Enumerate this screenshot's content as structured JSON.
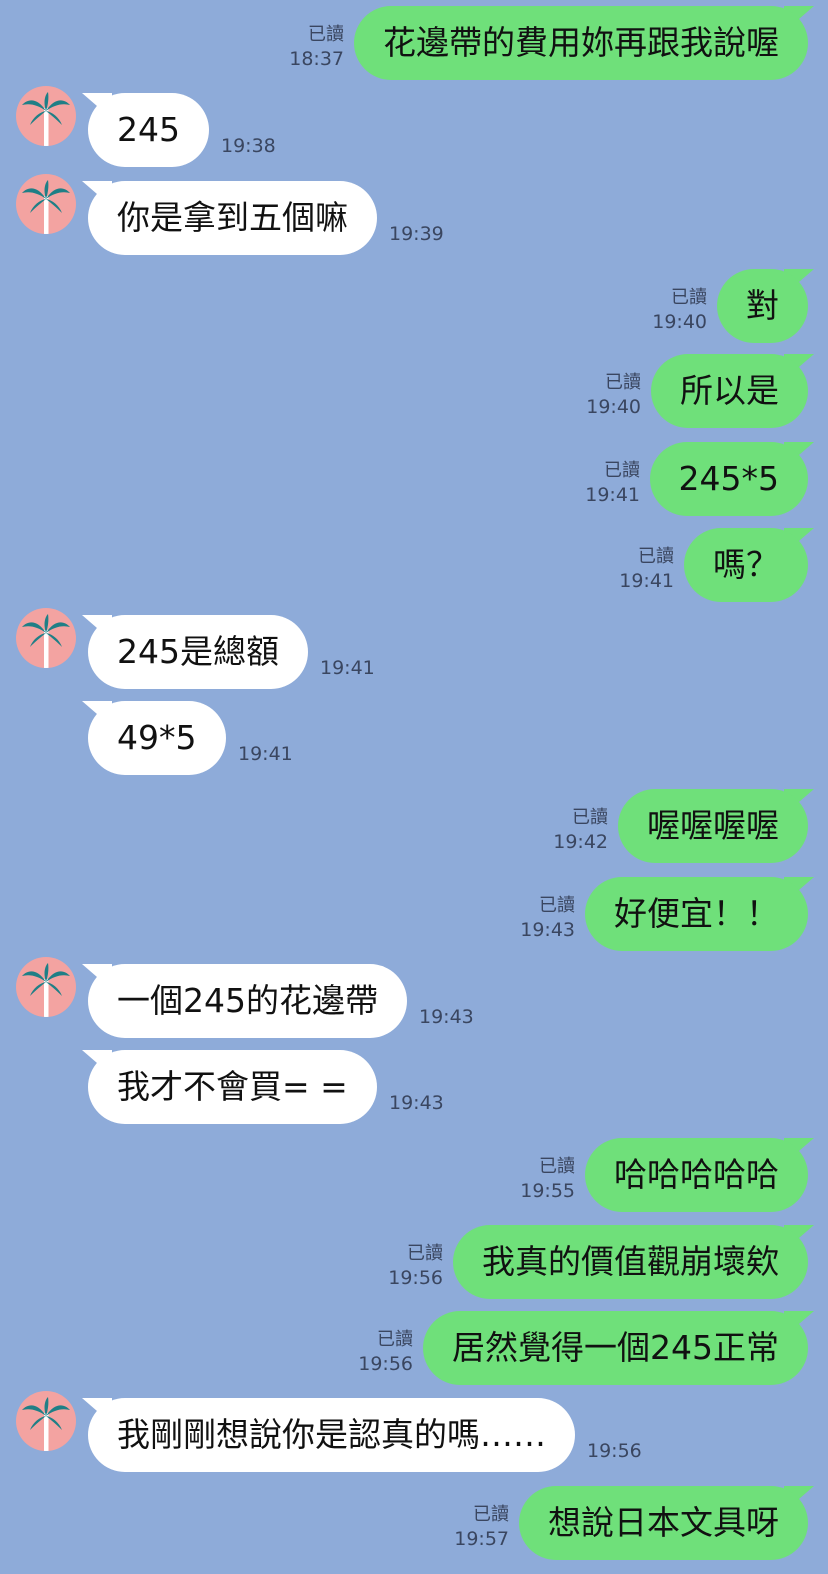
{
  "read_label": "已讀",
  "colors": {
    "background": "#8eabd9",
    "outgoing_bubble": "#6fe07a",
    "incoming_bubble": "#ffffff",
    "avatar": "#f3a3a1",
    "palm": "#1f7f86"
  },
  "avatar_icon": "palm-tree-icon",
  "messages": [
    {
      "dir": "out",
      "text": "花邊帶的費用妳再跟我說喔",
      "time": "18:37",
      "read": true
    },
    {
      "dir": "in",
      "text": "245",
      "time": "19:38",
      "avatar": true
    },
    {
      "dir": "in",
      "text": "你是拿到五個嘛",
      "time": "19:39",
      "avatar": true
    },
    {
      "dir": "out",
      "text": "對",
      "time": "19:40",
      "read": true
    },
    {
      "dir": "out",
      "text": "所以是",
      "time": "19:40",
      "read": true
    },
    {
      "dir": "out",
      "text": "245*5",
      "time": "19:41",
      "read": true
    },
    {
      "dir": "out",
      "text": "嗎？",
      "time": "19:41",
      "read": true
    },
    {
      "dir": "in",
      "text": "245是總額",
      "time": "19:41",
      "avatar": true
    },
    {
      "dir": "in",
      "text": "49*5",
      "time": "19:41",
      "avatar": false
    },
    {
      "dir": "out",
      "text": "喔喔喔喔",
      "time": "19:42",
      "read": true
    },
    {
      "dir": "out",
      "text": "好便宜！！",
      "time": "19:43",
      "read": true
    },
    {
      "dir": "in",
      "text": "一個245的花邊帶",
      "time": "19:43",
      "avatar": true
    },
    {
      "dir": "in",
      "text": "我才不會買= =",
      "time": "19:43",
      "avatar": false
    },
    {
      "dir": "out",
      "text": "哈哈哈哈哈",
      "time": "19:55",
      "read": true
    },
    {
      "dir": "out",
      "text": "我真的價值觀崩壞欸",
      "time": "19:56",
      "read": true
    },
    {
      "dir": "out",
      "text": "居然覺得一個245正常",
      "time": "19:56",
      "read": true
    },
    {
      "dir": "in",
      "text": "我剛剛想說你是認真的嗎……",
      "time": "19:56",
      "avatar": true
    },
    {
      "dir": "out",
      "text": "想說日本文具呀",
      "time": "19:57",
      "read": true
    }
  ]
}
